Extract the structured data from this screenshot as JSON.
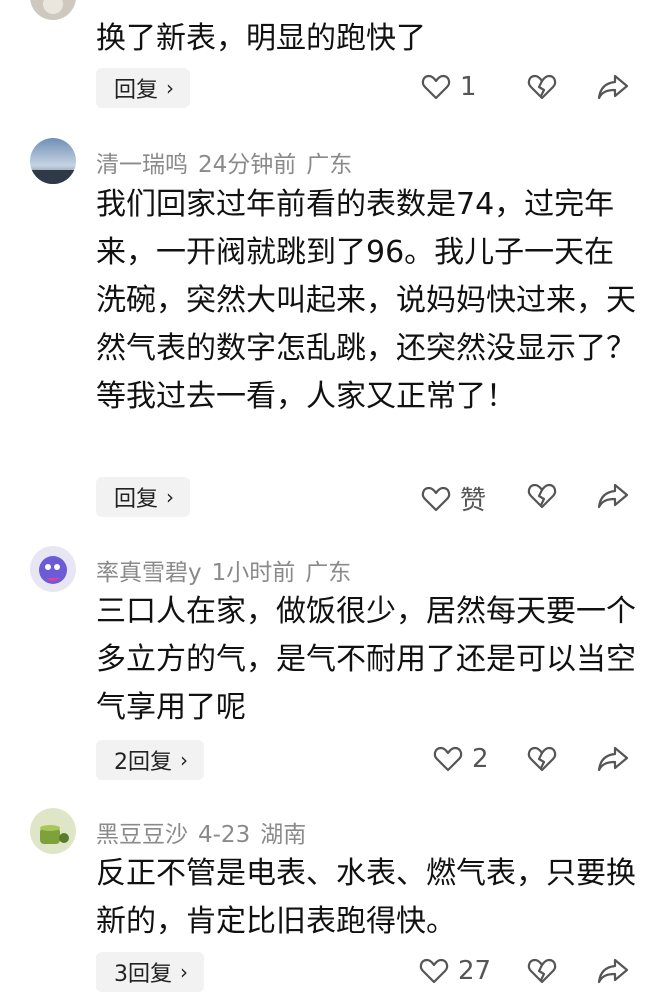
{
  "comments": [
    {
      "username": "",
      "time": "",
      "location": "",
      "text": "换了新表，明显的跑快了",
      "reply_label": "回复",
      "likes": "1"
    },
    {
      "username": "清一瑞鸣",
      "time": "24分钟前",
      "location": "广东",
      "text": "我们回家过年前看的表数是74，过完年来，一开阀就跳到了96。我儿子一天在洗碗，突然大叫起来，说妈妈快过来，天然气表的数字怎乱跳，还突然没显示了？等我过去一看，人家又正常了！",
      "reply_label": "回复",
      "likes": "赞"
    },
    {
      "username": "率真雪碧y",
      "time": "1小时前",
      "location": "广东",
      "text": "三口人在家，做饭很少，居然每天要一个多立方的气，是气不耐用了还是可以当空气享用了呢",
      "reply_label": "2回复",
      "likes": "2"
    },
    {
      "username": "黑豆豆沙",
      "time": "4-23",
      "location": "湖南",
      "text": "反正不管是电表、水表、燃气表，只要换新的，肯定比旧表跑得快。",
      "reply_label": "3回复",
      "likes": "27"
    }
  ],
  "icons": {
    "like": "heart-outline-icon",
    "unlike": "broken-heart-icon",
    "share": "share-arrow-icon",
    "chevron": "chevron-right-icon"
  },
  "colors": {
    "meta": "#8a8a8a",
    "reply_bg": "#f2f2f2",
    "icon": "#555555"
  }
}
